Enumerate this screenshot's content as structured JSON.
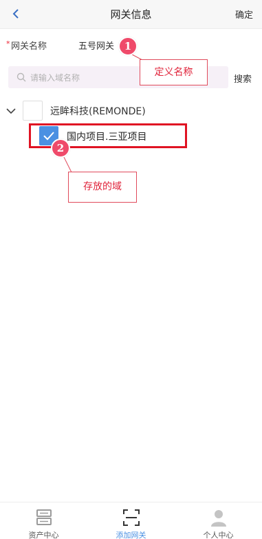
{
  "header": {
    "title": "网关信息",
    "confirm_label": "确定"
  },
  "form": {
    "required_mark": "*",
    "name_label": "网关名称",
    "name_value": "五号网关"
  },
  "search": {
    "placeholder": "请输入域名称",
    "button_label": "搜索"
  },
  "tree": {
    "parent_label": "远眸科技(REMONDE)",
    "child_label": "国内项目.三亚项目",
    "child_checked": true
  },
  "annotations": [
    {
      "number": "1",
      "text": "定义名称"
    },
    {
      "number": "2",
      "text": "存放的域"
    }
  ],
  "tabbar": {
    "active_index": 1,
    "items": [
      {
        "label": "资产中心",
        "icon": "server-icon"
      },
      {
        "label": "添加网关",
        "icon": "scan-icon"
      },
      {
        "label": "个人中心",
        "icon": "user-icon"
      }
    ]
  },
  "colors": {
    "accent": "#4a90e2",
    "highlight_border": "#e01323",
    "badge": "#ef4a6a"
  }
}
